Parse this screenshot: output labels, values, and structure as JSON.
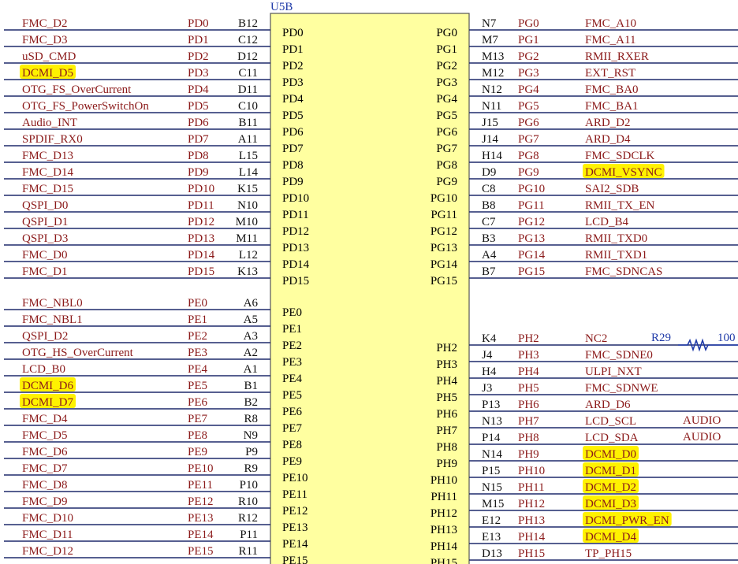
{
  "component": {
    "designator": "U5B",
    "body_color": "#ffffa0",
    "highlight_color": "#fff200",
    "wire_color": "#1f2a6b",
    "net_color": "#8b1a1a",
    "ref_color": "#1f3aa8"
  },
  "left_pins": [
    {
      "net": "FMC_D2",
      "port": "PD0",
      "ball": "B12",
      "highlighted": false
    },
    {
      "net": "FMC_D3",
      "port": "PD1",
      "ball": "C12",
      "highlighted": false
    },
    {
      "net": "uSD_CMD",
      "port": "PD2",
      "ball": "D12",
      "highlighted": false
    },
    {
      "net": "DCMI_D5",
      "port": "PD3",
      "ball": "C11",
      "highlighted": true
    },
    {
      "net": "OTG_FS_OverCurrent",
      "port": "PD4",
      "ball": "D11",
      "highlighted": false
    },
    {
      "net": "OTG_FS_PowerSwitchOn",
      "port": "PD5",
      "ball": "C10",
      "highlighted": false
    },
    {
      "net": "Audio_INT",
      "port": "PD6",
      "ball": "B11",
      "highlighted": false
    },
    {
      "net": "SPDIF_RX0",
      "port": "PD7",
      "ball": "A11",
      "highlighted": false
    },
    {
      "net": "FMC_D13",
      "port": "PD8",
      "ball": "L15",
      "highlighted": false
    },
    {
      "net": "FMC_D14",
      "port": "PD9",
      "ball": "L14",
      "highlighted": false
    },
    {
      "net": "FMC_D15",
      "port": "PD10",
      "ball": "K15",
      "highlighted": false
    },
    {
      "net": "QSPI_D0",
      "port": "PD11",
      "ball": "N10",
      "highlighted": false
    },
    {
      "net": "QSPI_D1",
      "port": "PD12",
      "ball": "M10",
      "highlighted": false
    },
    {
      "net": "QSPI_D3",
      "port": "PD13",
      "ball": "M11",
      "highlighted": false
    },
    {
      "net": "FMC_D0",
      "port": "PD14",
      "ball": "L12",
      "highlighted": false
    },
    {
      "net": "FMC_D1",
      "port": "PD15",
      "ball": "K13",
      "highlighted": false
    },
    {
      "net": "FMC_NBL0",
      "port": "PE0",
      "ball": "A6",
      "highlighted": false
    },
    {
      "net": "FMC_NBL1",
      "port": "PE1",
      "ball": "A5",
      "highlighted": false
    },
    {
      "net": "QSPI_D2",
      "port": "PE2",
      "ball": "A3",
      "highlighted": false
    },
    {
      "net": "OTG_HS_OverCurrent",
      "port": "PE3",
      "ball": "A2",
      "highlighted": false
    },
    {
      "net": "LCD_B0",
      "port": "PE4",
      "ball": "A1",
      "highlighted": false
    },
    {
      "net": "DCMI_D6",
      "port": "PE5",
      "ball": "B1",
      "highlighted": true
    },
    {
      "net": "DCMI_D7",
      "port": "PE6",
      "ball": "B2",
      "highlighted": true
    },
    {
      "net": "FMC_D4",
      "port": "PE7",
      "ball": "R8",
      "highlighted": false
    },
    {
      "net": "FMC_D5",
      "port": "PE8",
      "ball": "N9",
      "highlighted": false
    },
    {
      "net": "FMC_D6",
      "port": "PE9",
      "ball": "P9",
      "highlighted": false
    },
    {
      "net": "FMC_D7",
      "port": "PE10",
      "ball": "R9",
      "highlighted": false
    },
    {
      "net": "FMC_D8",
      "port": "PE11",
      "ball": "P10",
      "highlighted": false
    },
    {
      "net": "FMC_D9",
      "port": "PE12",
      "ball": "R10",
      "highlighted": false
    },
    {
      "net": "FMC_D10",
      "port": "PE13",
      "ball": "R12",
      "highlighted": false
    },
    {
      "net": "FMC_D11",
      "port": "PE14",
      "ball": "P11",
      "highlighted": false
    },
    {
      "net": "FMC_D12",
      "port": "PE15",
      "ball": "R11",
      "highlighted": false
    }
  ],
  "right_pins": [
    {
      "net": "FMC_A10",
      "port": "PG0",
      "ball": "N7",
      "highlighted": false
    },
    {
      "net": "FMC_A11",
      "port": "PG1",
      "ball": "M7",
      "highlighted": false
    },
    {
      "net": "RMII_RXER",
      "port": "PG2",
      "ball": "M13",
      "highlighted": false
    },
    {
      "net": "EXT_RST",
      "port": "PG3",
      "ball": "M12",
      "highlighted": false
    },
    {
      "net": "FMC_BA0",
      "port": "PG4",
      "ball": "N12",
      "highlighted": false
    },
    {
      "net": "FMC_BA1",
      "port": "PG5",
      "ball": "N11",
      "highlighted": false
    },
    {
      "net": "ARD_D2",
      "port": "PG6",
      "ball": "J15",
      "highlighted": false
    },
    {
      "net": "ARD_D4",
      "port": "PG7",
      "ball": "J14",
      "highlighted": false
    },
    {
      "net": "FMC_SDCLK",
      "port": "PG8",
      "ball": "H14",
      "highlighted": false
    },
    {
      "net": "DCMI_VSYNC",
      "port": "PG9",
      "ball": "D9",
      "highlighted": true
    },
    {
      "net": "SAI2_SDB",
      "port": "PG10",
      "ball": "C8",
      "highlighted": false
    },
    {
      "net": "RMII_TX_EN",
      "port": "PG11",
      "ball": "B8",
      "highlighted": false
    },
    {
      "net": "LCD_B4",
      "port": "PG12",
      "ball": "C7",
      "highlighted": false
    },
    {
      "net": "RMII_TXD0",
      "port": "PG13",
      "ball": "B3",
      "highlighted": false
    },
    {
      "net": "RMII_TXD1",
      "port": "PG14",
      "ball": "A4",
      "highlighted": false
    },
    {
      "net": "FMC_SDNCAS",
      "port": "PG15",
      "ball": "B7",
      "highlighted": false
    },
    {
      "net": "NC2",
      "port": "PH2",
      "ball": "K4",
      "highlighted": false
    },
    {
      "net": "FMC_SDNE0",
      "port": "PH3",
      "ball": "J4",
      "highlighted": false
    },
    {
      "net": "ULPI_NXT",
      "port": "PH4",
      "ball": "H4",
      "highlighted": false
    },
    {
      "net": "FMC_SDNWE",
      "port": "PH5",
      "ball": "J3",
      "highlighted": false
    },
    {
      "net": "ARD_D6",
      "port": "PH6",
      "ball": "P13",
      "highlighted": false
    },
    {
      "net": "LCD_SCL",
      "port": "PH7",
      "ball": "N13",
      "highlighted": false
    },
    {
      "net": "LCD_SDA",
      "port": "PH8",
      "ball": "P14",
      "highlighted": false
    },
    {
      "net": "DCMI_D0",
      "port": "PH9",
      "ball": "N14",
      "highlighted": true
    },
    {
      "net": "DCMI_D1",
      "port": "PH10",
      "ball": "P15",
      "highlighted": true
    },
    {
      "net": "DCMI_D2",
      "port": "PH11",
      "ball": "N15",
      "highlighted": true
    },
    {
      "net": "DCMI_D3",
      "port": "PH12",
      "ball": "M15",
      "highlighted": true
    },
    {
      "net": "DCMI_PWR_EN",
      "port": "PH13",
      "ball": "E12",
      "highlighted": true
    },
    {
      "net": "DCMI_D4",
      "port": "PH14",
      "ball": "E13",
      "highlighted": true
    },
    {
      "net": "TP_PH15",
      "port": "PH15",
      "ball": "D13",
      "highlighted": false
    }
  ],
  "extras": {
    "resistor_ref": "R29",
    "resistor_value": "100",
    "audio_labels": [
      "AUDIO",
      "AUDIO"
    ]
  }
}
